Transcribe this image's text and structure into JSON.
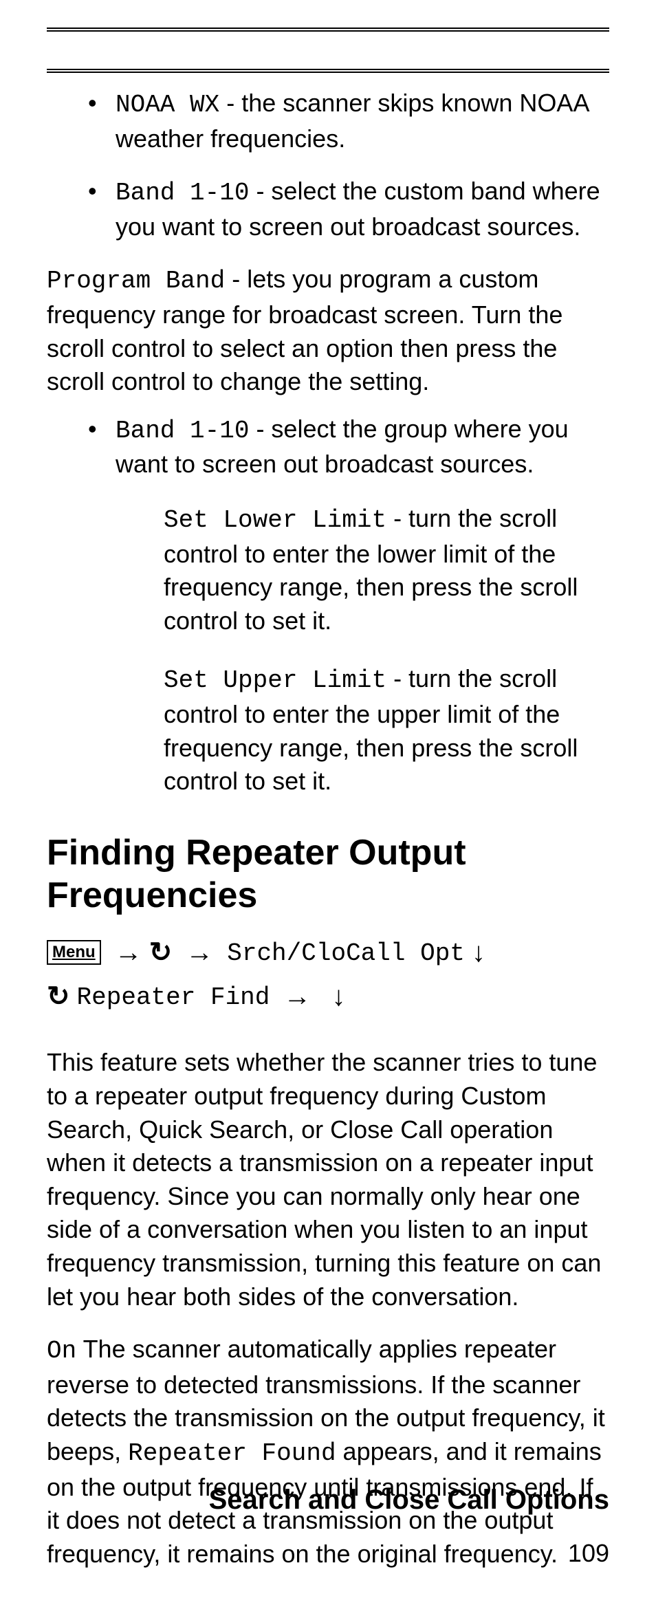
{
  "bullets_top": [
    {
      "code": "NOAA WX",
      "text": " - the scanner skips known NOAA weather frequencies."
    },
    {
      "code": "Band 1-10",
      "text": " - select the custom band where you want to screen out broadcast sources."
    }
  ],
  "program_band": {
    "code": "Program Band",
    "text": " - lets you program a custom frequency range for broadcast screen. Turn the scroll control to select an option then press the scroll control to change the setting."
  },
  "bullets_mid": [
    {
      "code": "Band 1-10",
      "text": " - select the group where you want to screen out broadcast sources."
    }
  ],
  "sub_items": [
    {
      "code": "Set Lower Limit",
      "text": " - turn the scroll control to enter the lower limit of the frequency range, then press the scroll control to set it."
    },
    {
      "code": "Set Upper Limit",
      "text": " - turn the scroll control to enter the upper limit of the frequency range, then press the scroll control to set it."
    }
  ],
  "heading": "Finding Repeater Output Frequencies",
  "nav": {
    "menu": "Menu",
    "opt": "Srch/CloCall Opt",
    "repeater": "Repeater Find"
  },
  "feature_para": "This feature sets whether the scanner tries to tune to a repeater output frequency during Custom Search, Quick Search, or Close Call operation when it detects a transmission on a repeater input frequency. Since you can normally only hear one side of a conversation when you listen to an input frequency transmission, turning this feature on can let you hear both sides of the conversation.",
  "on_para": {
    "code_on": "On",
    "pre": " The scanner automatically applies repeater reverse to detected transmissions. If the scanner detects the transmission on the output frequency, it beeps, ",
    "code_rf": "Repeater Found",
    "post": " appears, and it remains on the output frequency until transmissions end. If it does not detect a transmission on the output frequency, it remains on the original frequency."
  },
  "footer_title": "Search and Close Call Options",
  "page_number": "109"
}
